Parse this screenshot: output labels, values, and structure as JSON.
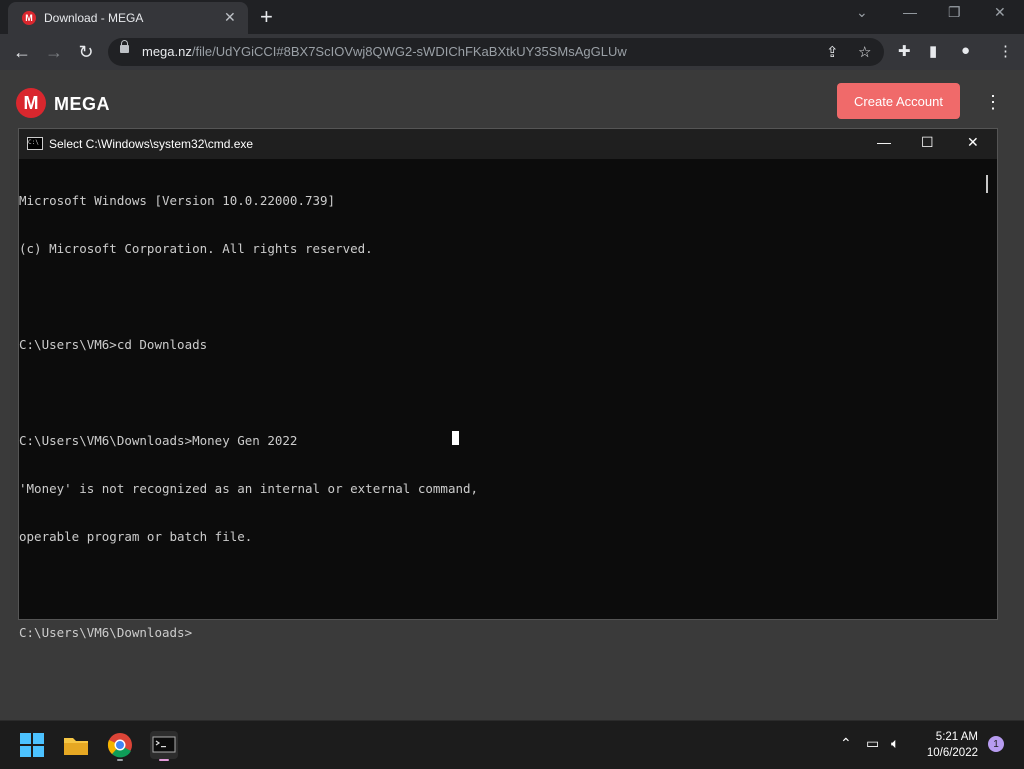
{
  "browser": {
    "tab_title": "Download - MEGA",
    "tab_favicon": "M",
    "url_host": "mega.nz",
    "url_path": "/file/UdYGiCCI#8BX7ScIOVwj8QWG2-sWDIChFKaBXtkUY35SMsAgGLUw",
    "icons": [
      "back-icon",
      "forward-icon",
      "reload-icon",
      "lock-icon",
      "share-icon",
      "star-icon",
      "extensions-icon",
      "sidepanel-icon",
      "profile-icon",
      "menu-icon"
    ]
  },
  "mega": {
    "logo_letter": "M",
    "name": "MEGA",
    "create_account": "Create Account"
  },
  "cmd": {
    "title": "Select C:\\Windows\\system32\\cmd.exe",
    "lines": [
      "Microsoft Windows [Version 10.0.22000.739]",
      "(c) Microsoft Corporation. All rights reserved.",
      "",
      "C:\\Users\\VM6>cd Downloads",
      "",
      "C:\\Users\\VM6\\Downloads>Money Gen 2022",
      "'Money' is not recognized as an internal or external command,",
      "operable program or batch file.",
      "",
      "C:\\Users\\VM6\\Downloads>"
    ]
  },
  "taskbar": {
    "time": "5:21 AM",
    "date": "10/6/2022",
    "notification_count": "1"
  },
  "colors": {
    "mega_red": "#d9272e",
    "create_button": "#f06a6a",
    "console_bg": "#0c0c0c"
  }
}
